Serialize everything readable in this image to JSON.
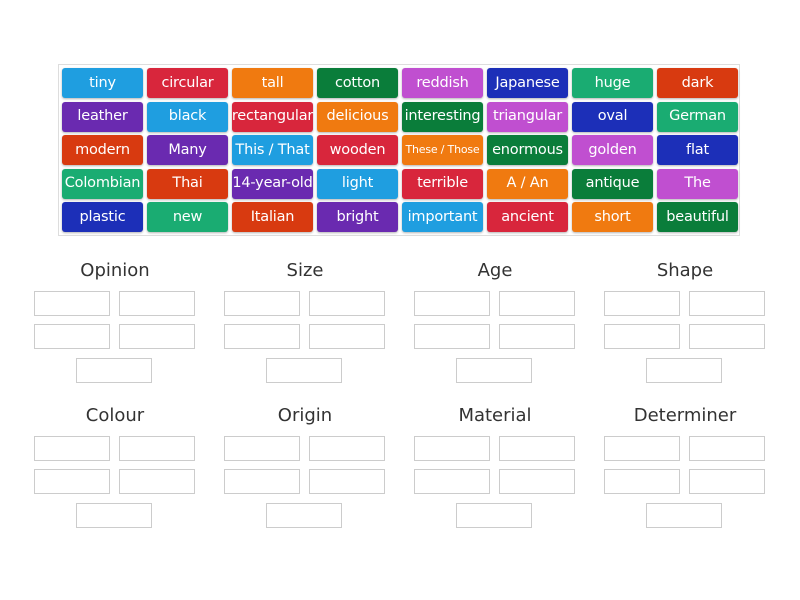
{
  "colors": {
    "sky": "#1f9ee0",
    "red": "#d8263c",
    "orange": "#f07a10",
    "dgreen": "#0a7d3a",
    "pink": "#c04fd0",
    "navy": "#1c2fb8",
    "purple": "#6a2ab0",
    "orangered": "#d83a10",
    "teal": "#1aac72"
  },
  "tiles": [
    [
      {
        "t": "tiny",
        "c": "sky"
      },
      {
        "t": "circular",
        "c": "red"
      },
      {
        "t": "tall",
        "c": "orange"
      },
      {
        "t": "cotton",
        "c": "dgreen"
      },
      {
        "t": "reddish",
        "c": "pink"
      },
      {
        "t": "Japanese",
        "c": "navy"
      },
      {
        "t": "huge",
        "c": "teal"
      },
      {
        "t": "dark",
        "c": "orangered"
      }
    ],
    [
      {
        "t": "leather",
        "c": "purple"
      },
      {
        "t": "black",
        "c": "sky"
      },
      {
        "t": "rectangular",
        "c": "red"
      },
      {
        "t": "delicious",
        "c": "orange"
      },
      {
        "t": "interesting",
        "c": "dgreen"
      },
      {
        "t": "triangular",
        "c": "pink"
      },
      {
        "t": "oval",
        "c": "navy"
      },
      {
        "t": "German",
        "c": "teal"
      }
    ],
    [
      {
        "t": "modern",
        "c": "orangered"
      },
      {
        "t": "Many",
        "c": "purple"
      },
      {
        "t": "This / That",
        "c": "sky"
      },
      {
        "t": "wooden",
        "c": "red"
      },
      {
        "t": "These / Those",
        "c": "orange"
      },
      {
        "t": "enormous",
        "c": "dgreen"
      },
      {
        "t": "golden",
        "c": "pink"
      },
      {
        "t": "flat",
        "c": "navy"
      }
    ],
    [
      {
        "t": "Colombian",
        "c": "teal"
      },
      {
        "t": "Thai",
        "c": "orangered"
      },
      {
        "t": "14-year-old",
        "c": "purple"
      },
      {
        "t": "light",
        "c": "sky"
      },
      {
        "t": "terrible",
        "c": "red"
      },
      {
        "t": "A / An",
        "c": "orange"
      },
      {
        "t": "antique",
        "c": "dgreen"
      },
      {
        "t": "The",
        "c": "pink"
      }
    ],
    [
      {
        "t": "plastic",
        "c": "navy"
      },
      {
        "t": "new",
        "c": "teal"
      },
      {
        "t": "Italian",
        "c": "orangered"
      },
      {
        "t": "bright",
        "c": "purple"
      },
      {
        "t": "important",
        "c": "sky"
      },
      {
        "t": "ancient",
        "c": "red"
      },
      {
        "t": "short",
        "c": "orange"
      },
      {
        "t": "beautiful",
        "c": "dgreen"
      }
    ]
  ],
  "groups": [
    "Opinion",
    "Size",
    "Age",
    "Shape",
    "Colour",
    "Origin",
    "Material",
    "Determiner"
  ]
}
